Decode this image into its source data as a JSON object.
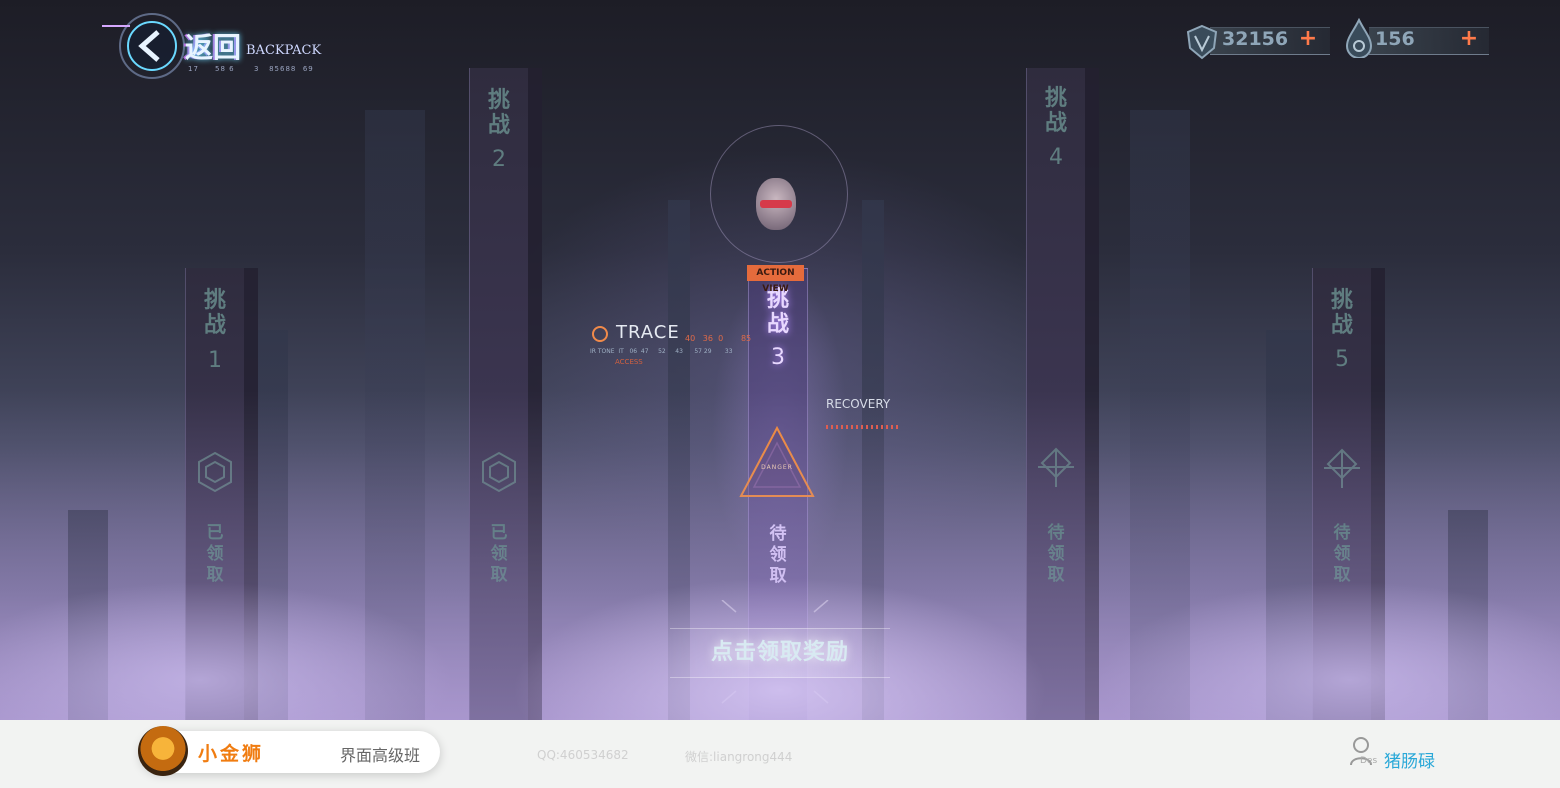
{
  "back": {
    "label": "返回",
    "sub": "BACKPACK",
    "codes": "17     58 6      3   85688  69"
  },
  "currency": [
    {
      "icon": "shield-wings-icon",
      "value": "32156",
      "plus": "+"
    },
    {
      "icon": "drop-icon",
      "value": "156",
      "plus": "+"
    }
  ],
  "challenges": [
    {
      "title": "挑\n战",
      "num": "1",
      "status": "已\n领\n取",
      "emblem": "hex-emblem-icon"
    },
    {
      "title": "挑\n战",
      "num": "2",
      "status": "已\n领\n取",
      "emblem": "hex-emblem-icon"
    },
    {
      "title": "挑\n战",
      "num": "3",
      "status": "待\n领\n取",
      "emblem": "danger-triangle-icon"
    },
    {
      "title": "挑\n战",
      "num": "4",
      "status": "待\n领\n取",
      "emblem": "hex-emblem-icon"
    },
    {
      "title": "挑\n战",
      "num": "5",
      "status": "待\n领\n取",
      "emblem": "hex-emblem-icon"
    }
  ],
  "hud": {
    "action_tag": "ACTION VIEW",
    "trace_title": "TRACE",
    "trace_nums": "40   36  0       85",
    "trace_sub": "IR TONE  IT   06  47     52     43      57 29       33",
    "trace_access": "ACCESS",
    "recovery": "RECOVERY",
    "danger": "DANGER"
  },
  "claim_button": "点击领取奖励",
  "footer": {
    "brand_name": "小金狮",
    "brand_class": "界面高级班",
    "qq": "QQ:460534682",
    "wechat": "微信:liangrong444",
    "designer_tag": "Des",
    "designer_name": "猪肠碌"
  },
  "colors": {
    "accent": "#e56b3c",
    "plus": "#ff7a4a",
    "pillar_text": "#5f7d80",
    "designer": "#2aa8d8"
  }
}
